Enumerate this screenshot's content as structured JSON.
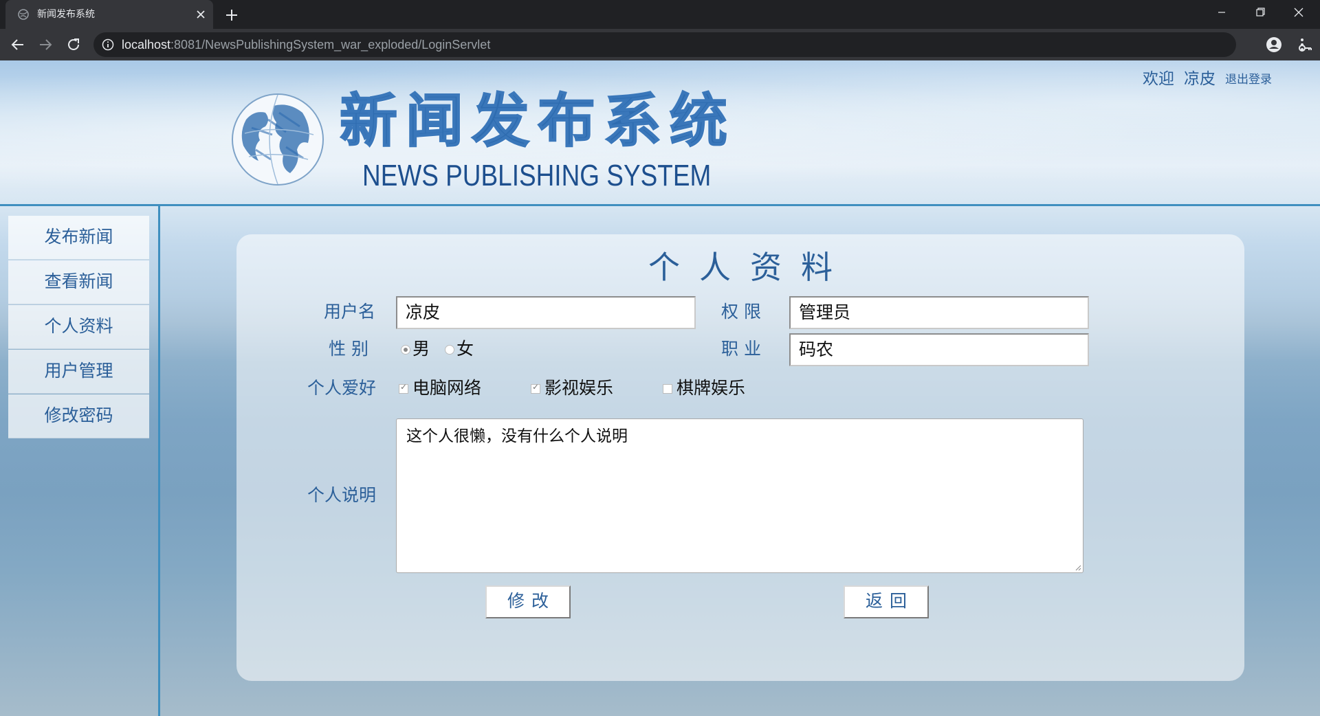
{
  "browser": {
    "tab_title": "新闻发布系统",
    "url_host": "localhost",
    "url_rest": ":8081/NewsPublishingSystem_war_exploded/LoginServlet"
  },
  "header": {
    "logo_cn": "新闻发布系统",
    "logo_en": "NEWS PUBLISHING SYSTEM",
    "welcome": "欢迎",
    "username": "凉皮",
    "logout": "退出登录"
  },
  "sidebar": {
    "items": [
      {
        "label": "发布新闻"
      },
      {
        "label": "查看新闻"
      },
      {
        "label": "个人资料"
      },
      {
        "label": "用户管理"
      },
      {
        "label": "修改密码"
      }
    ]
  },
  "profile": {
    "title": "个人资料",
    "username_label": "用户名",
    "username_value": "凉皮",
    "role_label": "权 限",
    "role_value": "管理员",
    "gender_label": "性 别",
    "gender_options": [
      "男",
      "女"
    ],
    "gender_selected": "男",
    "job_label": "职 业",
    "job_value": "码农",
    "hobby_label": "个人爱好",
    "hobbies": [
      {
        "label": "电脑网络",
        "checked": true
      },
      {
        "label": "影视娱乐",
        "checked": true
      },
      {
        "label": "棋牌娱乐",
        "checked": false
      }
    ],
    "desc_label": "个人说明",
    "desc_value": "这个人很懒，没有什么个人说明",
    "modify_button": "修改",
    "back_button": "返回"
  },
  "colors": {
    "accent": "#2b5f99",
    "header_line": "#3f8fbf"
  }
}
